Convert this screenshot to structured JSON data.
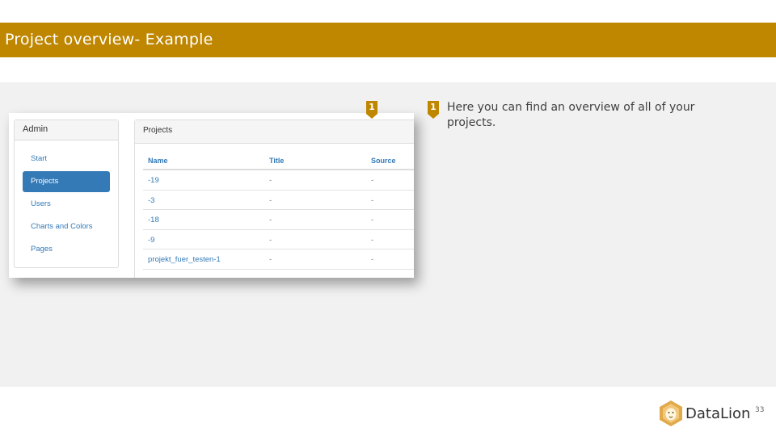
{
  "slide": {
    "title": "Project overview- Example",
    "note_marker": "1",
    "note_text": "Here you can find an overview of all of your projects.",
    "page_number": "33",
    "logo_text": "DataLion"
  },
  "colors": {
    "title_bar": "#bf8600",
    "accent_blue": "#337ab7",
    "marker": "#bf8600"
  },
  "screenshot": {
    "marker": "1",
    "admin": {
      "heading": "Admin",
      "nav": [
        {
          "label": "Start",
          "active": false
        },
        {
          "label": "Projects",
          "active": true
        },
        {
          "label": "Users",
          "active": false
        },
        {
          "label": "Charts and Colors",
          "active": false
        },
        {
          "label": "Pages",
          "active": false
        }
      ]
    },
    "projects": {
      "heading": "Projects",
      "columns": [
        "Name",
        "Title",
        "Source"
      ],
      "rows": [
        [
          "-19",
          "-",
          "-"
        ],
        [
          "-3",
          "-",
          "-"
        ],
        [
          "-18",
          "-",
          "-"
        ],
        [
          "-9",
          "-",
          "-"
        ],
        [
          "projekt_fuer_testen-1",
          "-",
          "-"
        ]
      ]
    }
  }
}
